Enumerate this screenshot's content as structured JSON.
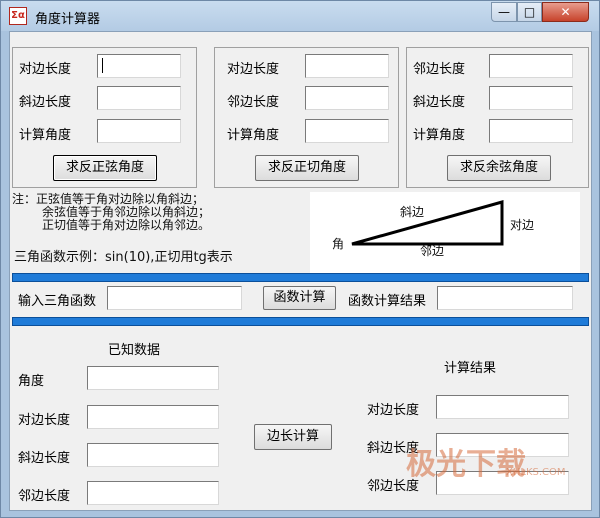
{
  "window": {
    "title": "角度计算器",
    "icon_text": "Σα",
    "controls": {
      "minimize": "—",
      "maximize": "□",
      "close": "✕"
    }
  },
  "groups": [
    {
      "labels": [
        "对边长度",
        "斜边长度",
        "计算角度"
      ],
      "button": "求反正弦角度"
    },
    {
      "labels": [
        "对边长度",
        "邻边长度",
        "计算角度"
      ],
      "button": "求反正切角度"
    },
    {
      "labels": [
        "邻边长度",
        "斜边长度",
        "计算角度"
      ],
      "button": "求反余弦角度"
    }
  ],
  "notes": {
    "line1": "注：正弦值等于角对边除以角斜边；",
    "line2": "余弦值等于角邻边除以角斜边；",
    "line3": "正切值等于角对边除以角邻边。",
    "example": "三角函数示例：sin(10),正切用tg表示"
  },
  "diagram": {
    "hyp": "斜边",
    "opp": "对边",
    "adj": "邻边",
    "angle": "角"
  },
  "func_row": {
    "input_label": "输入三角函数",
    "button": "函数计算",
    "result_label": "函数计算结果"
  },
  "known": {
    "heading": "已知数据",
    "labels": [
      "角度",
      "对边长度",
      "斜边长度",
      "邻边长度"
    ]
  },
  "calc_button": "边长计算",
  "results": {
    "heading": "计算结果",
    "labels": [
      "对边长度",
      "斜边长度",
      "邻边长度"
    ]
  },
  "watermark": {
    "text": "极光下载",
    "sub": "XHLKS.COM"
  }
}
